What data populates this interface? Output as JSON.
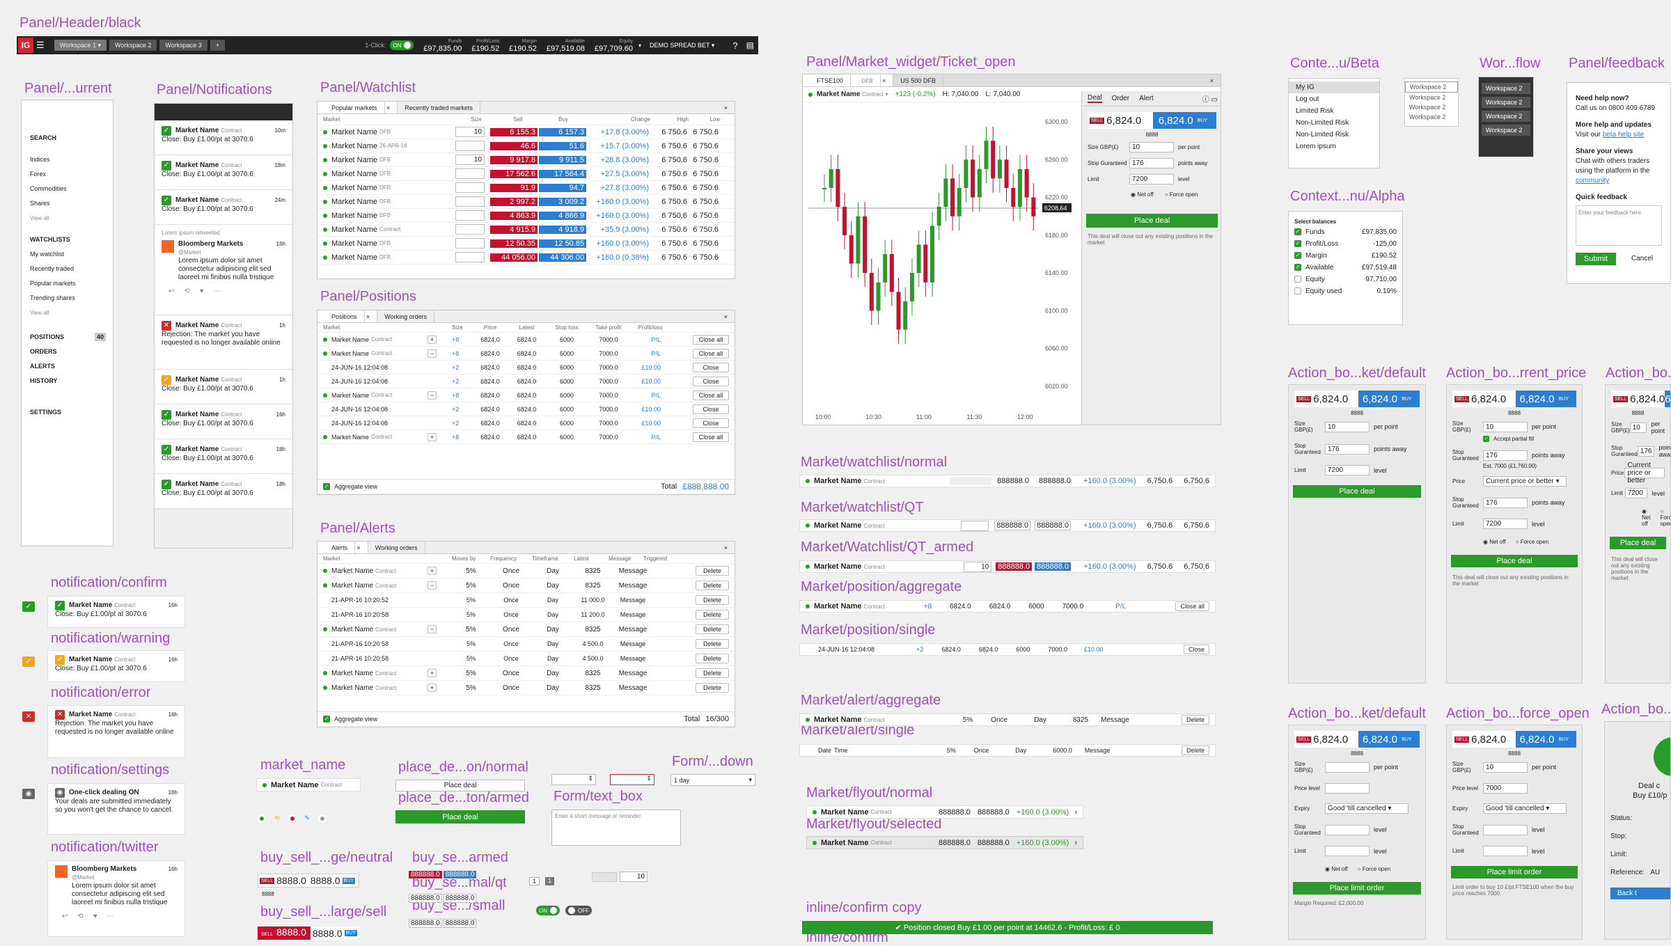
{
  "titles": {
    "header": "Panel/Header/black",
    "current": "Panel/...urrent",
    "notifications": "Panel/Notifications",
    "watchlist": "Panel/Watchlist",
    "positions": "Panel/Positions",
    "alerts": "Panel/Alerts",
    "ticket": "Panel/Market_widget/Ticket_open",
    "contextBeta": "Conte...u/Beta",
    "workflow": "Wor...flow",
    "feedback": "Panel/feedback",
    "contextAlpha": "Context...nu/Alpha",
    "wl_normal": "Market/watchlist/normal",
    "wl_qt": "Market/watchlist/QT",
    "wl_qt_armed": "Market/Watchlist/QT_armed",
    "pos_agg": "Market/position/aggregate",
    "pos_single": "Market/position/single",
    "alert_agg": "Market/alert/aggregate",
    "alert_single": "Market/alert/single",
    "flyout_normal": "Market/flyout/normal",
    "flyout_selected": "Market/flyout/selected",
    "inline_confirm_copy": "inline/confirm copy",
    "inline_confirm": "inline/confirm",
    "ab_default": "Action_bo...ket/default",
    "ab_current": "Action_bo...rrent_price",
    "ab_third": "Action_bo...",
    "ab_default2": "Action_bo...ket/default",
    "ab_force": "Action_bo...force_open",
    "ab_fourth": "Action_bo...",
    "n_confirm": "notification/confirm",
    "n_warning": "notification/warning",
    "n_error": "notification/error",
    "n_settings": "notification/settings",
    "n_twitter": "notification/twitter",
    "market_name": "market_name",
    "place_normal": "place_de...on/normal",
    "place_armed": "place_de...ton/armed",
    "form_down": "Form/...down",
    "form_text": "Form/text_box",
    "bs_neutral": "buy_sell_...ge/neutral",
    "bs_armed": "buy_se...armed",
    "bs_qt": "buy_se...mal/qt",
    "bs_small": "buy_se.../small",
    "bs_large": "buy_sell_...large/sell"
  },
  "header": {
    "workspaces": [
      "Workspace 1",
      "Workspace 2",
      "Workspace 3"
    ],
    "plus": "+",
    "oneclick": "1-Click:",
    "on": "ON",
    "metrics": [
      {
        "l": "Funds",
        "v": "£97,835.00"
      },
      {
        "l": "Profit/Loss",
        "v": "£190.52"
      },
      {
        "l": "Margin",
        "v": "£190.52"
      },
      {
        "l": "Available",
        "v": "£97,519.08"
      },
      {
        "l": "Equity",
        "v": "£97,709.60"
      }
    ],
    "account": "DEMO SPREAD BET",
    "logo": "IG"
  },
  "nav": {
    "search": "SEARCH",
    "markets": [
      "Indices",
      "Forex",
      "Commodities",
      "Shares"
    ],
    "viewall": "View all",
    "watchlists": "WATCHLISTS",
    "wl": [
      "My watchlist",
      "Recently traded",
      "Popular markets",
      "Trending shares"
    ],
    "viewall2": "View all",
    "positions": "POSITIONS",
    "poscount": "40",
    "orders": "ORDERS",
    "alerts": "ALERTS",
    "history": "HISTORY",
    "settings": "SETTINGS"
  },
  "notif": {
    "name": "Market Name",
    "contract": "Contract",
    "close": "Close: Buy £1.00/pt at 3070.6",
    "times": [
      "10m",
      "18m",
      "24m"
    ],
    "retweet": "Lorem ipsum retweeted",
    "bloomberg": "Bloomberg Markets",
    "handle": "@Market",
    "tweet": "Lorem ipsum dolor sit amet consectetur adipiscing elit sed laoreet mi finibus nulla tristique",
    "t16": "16h",
    "t1": "1h",
    "rejection": "Rejection: The market you have requested is no longer available online",
    "times2": [
      "1h",
      "16h",
      "18h",
      "18h"
    ]
  },
  "watchlist": {
    "tabs": [
      "Popular markets",
      "Recently traded markets"
    ],
    "cols": [
      "Market",
      "Size",
      "Sell",
      "Buy",
      "Change",
      "High",
      "Low"
    ],
    "rows": [
      [
        "Market Name",
        "DFB",
        "10",
        "6 155.3",
        "6 157.3",
        "+17.8 (3.00%)",
        "6 750.6",
        "6 750.6"
      ],
      [
        "Market Name",
        "26-APR-16",
        "",
        "46.6",
        "51.6",
        "+15.7 (3.00%)",
        "6 750.6",
        "6 750.6"
      ],
      [
        "Market Name",
        "DFB",
        "10",
        "9 917.8",
        "9 911.5",
        "+28.8 (3.00%)",
        "6 750.6",
        "6 750.6"
      ],
      [
        "Market Name",
        "DFB",
        "",
        "17 562.6",
        "17 564.4",
        "+27.5 (3.00%)",
        "6 750.6",
        "6 750.6"
      ],
      [
        "Market Name",
        "DFB",
        "",
        "91.9",
        "94.7",
        "+27.8 (3.00%)",
        "6 750.6",
        "6 750.6"
      ],
      [
        "Market Name",
        "DFB",
        "",
        "2 997.2",
        "3 009.2",
        "+160.0 (3.00%)",
        "6 750.6",
        "6 750.6"
      ],
      [
        "Market Name",
        "DFB",
        "",
        "4 863.9",
        "4 866.9",
        "+160.0 (3.00%)",
        "6 750.6",
        "6 750.6"
      ],
      [
        "Market Name",
        "Contract",
        "",
        "4 915.9",
        "4 918.9",
        "+35.9 (3.00%)",
        "6 750.6",
        "6 750.6"
      ],
      [
        "Market Name",
        "DFB",
        "",
        "12 50.35",
        "12 50.85",
        "+160.0 (3.00%)",
        "6 750.6",
        "6 750.6"
      ],
      [
        "Market Name",
        "DFB",
        "",
        "44 056.00",
        "44 306.00",
        "+160.0 (0.38%)",
        "6 750.6",
        "6 750.6"
      ]
    ]
  },
  "positions": {
    "tabs": [
      "Positions",
      "Working orders"
    ],
    "cols": [
      "Market",
      "Size",
      "Price",
      "Latest",
      "Stop loss",
      "Take profit",
      "Profit/loss"
    ],
    "rows": [
      [
        "Market Name",
        "+8",
        "6824.0",
        "6824.0",
        "6000",
        "7000.0",
        "P/L",
        "Close all"
      ],
      [
        "Market Name",
        "+8",
        "6824.0",
        "6824.0",
        "6000",
        "7000.0",
        "P/L",
        "Close all"
      ],
      [
        "24-JUN-16 12:04:08",
        "+2",
        "6824.0",
        "6824.0",
        "6000",
        "7000.0",
        "£10.00",
        "Close"
      ],
      [
        "24-JUN-16 12:04:08",
        "+2",
        "6824.0",
        "6824.0",
        "6000",
        "7000.0",
        "£10.00",
        "Close"
      ],
      [
        "Market Name",
        "+8",
        "6824.0",
        "6824.0",
        "6000",
        "7000.0",
        "P/L",
        "Close all"
      ],
      [
        "24-JUN-16 12:04:08",
        "+2",
        "6824.0",
        "6824.0",
        "6000",
        "7000.0",
        "£10.00",
        "Close"
      ],
      [
        "24-JUN-16 12:04:08",
        "+2",
        "6824.0",
        "6824.0",
        "6000",
        "7000.0",
        "£10.00",
        "Close"
      ],
      [
        "Market Name",
        "+8",
        "6824.0",
        "6824.0",
        "6000",
        "7000.0",
        "P/L",
        "Close all"
      ]
    ],
    "aggregate": "Aggregate view",
    "total": "Total",
    "totalv": "£888,888.00"
  },
  "alerts": {
    "tabs": [
      "Alerts",
      "Working orders"
    ],
    "cols": [
      "Market",
      "Moves by",
      "Frequency",
      "Timeframe",
      "Latest",
      "Message",
      "Triggered"
    ],
    "rows": [
      [
        "Market Name",
        "5%",
        "Once",
        "Day",
        "8325",
        "Message"
      ],
      [
        "Market Name",
        "5%",
        "Once",
        "Day",
        "8325",
        "Message"
      ],
      [
        "21-APR-16 10:20:52",
        "5%",
        "Once",
        "Day",
        "11 000.0",
        "Message"
      ],
      [
        "21-APR-16 10:20:58",
        "5%",
        "Once",
        "Day",
        "11 200.0",
        "Message"
      ],
      [
        "Market Name",
        "5%",
        "Once",
        "Day",
        "8325",
        "Message"
      ],
      [
        "21-APR-16 10:20:58",
        "5%",
        "Once",
        "Day",
        "4 500.0",
        "Message"
      ],
      [
        "21-APR-16 10:20:58",
        "5%",
        "Once",
        "Day",
        "4 500.0",
        "Message"
      ],
      [
        "Market Name",
        "5%",
        "Once",
        "Day",
        "8325",
        "Message"
      ],
      [
        "Market Name",
        "5%",
        "Once",
        "Day",
        "8325",
        "Message"
      ]
    ],
    "del": "Delete",
    "total": "Total",
    "totalv": "16/300"
  },
  "ticket": {
    "tabs": [
      "FTSE100",
      "US 500 DFB"
    ],
    "dfb": "DFB",
    "mname": "Market Name",
    "mcontract": "Contract",
    "change": "+123 (-0.2%)",
    "high": "H: 7,040.00",
    "low": "L: 7,040.00",
    "dtabs": [
      "Deal",
      "Order",
      "Alert"
    ],
    "sell": "6,824.0",
    "buy": "6,824.0",
    "spread": "8888",
    "size": "Size GBP(£)",
    "sizev": "10",
    "perpoint": "per point",
    "stop": "Stop Guranteed",
    "stopv": "176",
    "pointsaway": "points away",
    "limit": "Limit",
    "limitv": "7200",
    "level": "level",
    "netoff": "Net off",
    "force": "Force open",
    "place": "Place deal",
    "note": "This deal will close out any existing positions in the market",
    "yticks": [
      "6300.00",
      "6260.00",
      "6220.00",
      "6180.00",
      "6140.00",
      "6100.00",
      "6060.00",
      "6020.00"
    ],
    "xticks": [
      "10:00",
      "10:30",
      "11:00",
      "11:30",
      "12:00"
    ],
    "price": "6208.64"
  },
  "chart_data": {
    "type": "candlestick",
    "x": [
      "10:00",
      "10:30",
      "11:00",
      "11:30",
      "12:00"
    ],
    "ylim": [
      6020,
      6300
    ],
    "series": [
      {
        "values": [
          6230,
          6250,
          6210,
          6180,
          6150,
          6200,
          6140,
          6100,
          6130,
          6160,
          6120,
          6080,
          6110,
          6140,
          6170,
          6130,
          6190,
          6210,
          6240,
          6200,
          6230,
          6260,
          6220,
          6250,
          6280,
          6240,
          6260,
          6230,
          6210,
          6250,
          6220,
          6200
        ]
      }
    ]
  },
  "ctxBeta": [
    "My IG",
    "Log out",
    "Limited Risk",
    "Non-Limited Risk",
    "Non-Limited Risk",
    "Lorem ipsum"
  ],
  "workflow1": [
    "Workspace 2",
    "Workspace 2",
    "Workspace 2",
    "Workspace 2"
  ],
  "workflow2": [
    "Workspace 2",
    "Workspace 2",
    "Workspace 2",
    "Workspace 2"
  ],
  "ctxAlpha": {
    "title": "Select balances",
    "items": [
      [
        "Funds",
        "£97,835.00"
      ],
      [
        "Profit/Loss",
        "-125.00"
      ],
      [
        "Margin",
        "£190.52"
      ],
      [
        "Available",
        "£97,519.48"
      ],
      [
        "Equity",
        "97,710.00"
      ],
      [
        "Equity used",
        "0.19%"
      ]
    ]
  },
  "feedback": {
    "help": "Need help now?",
    "call": "Call us on 0800 409 6789",
    "more": "More help and updates",
    "visit": "Visit our",
    "beta": "beta help site",
    "share": "Share your views",
    "chat": "Chat with others traders using the platform in the",
    "community": "community",
    "quick": "Quick feedback",
    "placeholder": "Enter your feedback here",
    "submit": "Submit",
    "cancel": "Cancel"
  },
  "rows": {
    "name": "Market Name",
    "contract": "Contract",
    "v": "888888.0",
    "chg": "+160.0 (3.00%)",
    "hi": "6,750.6",
    "lo": "6,750.6",
    "size": "10",
    "pos": [
      "+8",
      "6824.0",
      "6824.0",
      "6000",
      "7000.0",
      "P/L",
      "Close all"
    ],
    "single": [
      "24-JUN-16 12:04:08",
      "+2",
      "6824.0",
      "6824.0",
      "6000",
      "7000.0",
      "£10.00",
      "Close"
    ],
    "alert": [
      "5%",
      "Once",
      "Day",
      "8325",
      "Message",
      "Delete"
    ],
    "alertS": [
      "Date",
      "Time",
      "5%",
      "Once",
      "Day",
      "6000.0",
      "Message",
      "Delete"
    ],
    "confirm": "Position closed Buy £1.00 per point at 14462.6 - Profit/Loss: £ 0"
  },
  "action": {
    "sell": "6,824.0",
    "buy": "6,824.0",
    "spread": "8888",
    "size": "Size GBP(£)",
    "sizev": "10",
    "pp": "per point",
    "partial": "Accept partial fill",
    "stop": "Stop Guranteed",
    "stopv": "176",
    "est": "Est. 7000 (£1,760.00)",
    "pa": "points away",
    "price": "Price",
    "pricev": "Current price or better",
    "limit": "Limit",
    "limitv": "7200",
    "level": "level",
    "netoff": "Net off",
    "force": "Force open",
    "place": "Place deal",
    "note": "This deal will close out any existing positions in the market",
    "pricelevel": "Price level",
    "expiry": "Expiry",
    "expv": "Good 'till cancelled",
    "level7000": "7000",
    "limitorder": "Place limit order",
    "margin": "Margin Required: £2,000.00",
    "limnote": "Limit order to buy 10 £/pt FTSE100 when the buy price reaches 7000.",
    "deal": "Deal c",
    "dealsub": "Buy £10/p",
    "status": "Status:",
    "stopl": "Stop:",
    "limitl": "Limit:",
    "ref": "Reference:",
    "refv": "AU",
    "back": "Back t"
  },
  "misc": {
    "oneclick": "One-click dealing ON",
    "oneclicknote": "Your deals are submitted immediately so you won't get the chance to cancel.",
    "mname": "Market Name",
    "contract": "Contract",
    "place": "Place deal",
    "day": "1 day",
    "textph": "Enter a short message or reminder",
    "bsv": "8888.0",
    "sell": "SELL",
    "buy": "BUY",
    "armed": "888888.0",
    "on": "ON",
    "off": "OFF",
    "step": "10",
    "one": "1"
  }
}
